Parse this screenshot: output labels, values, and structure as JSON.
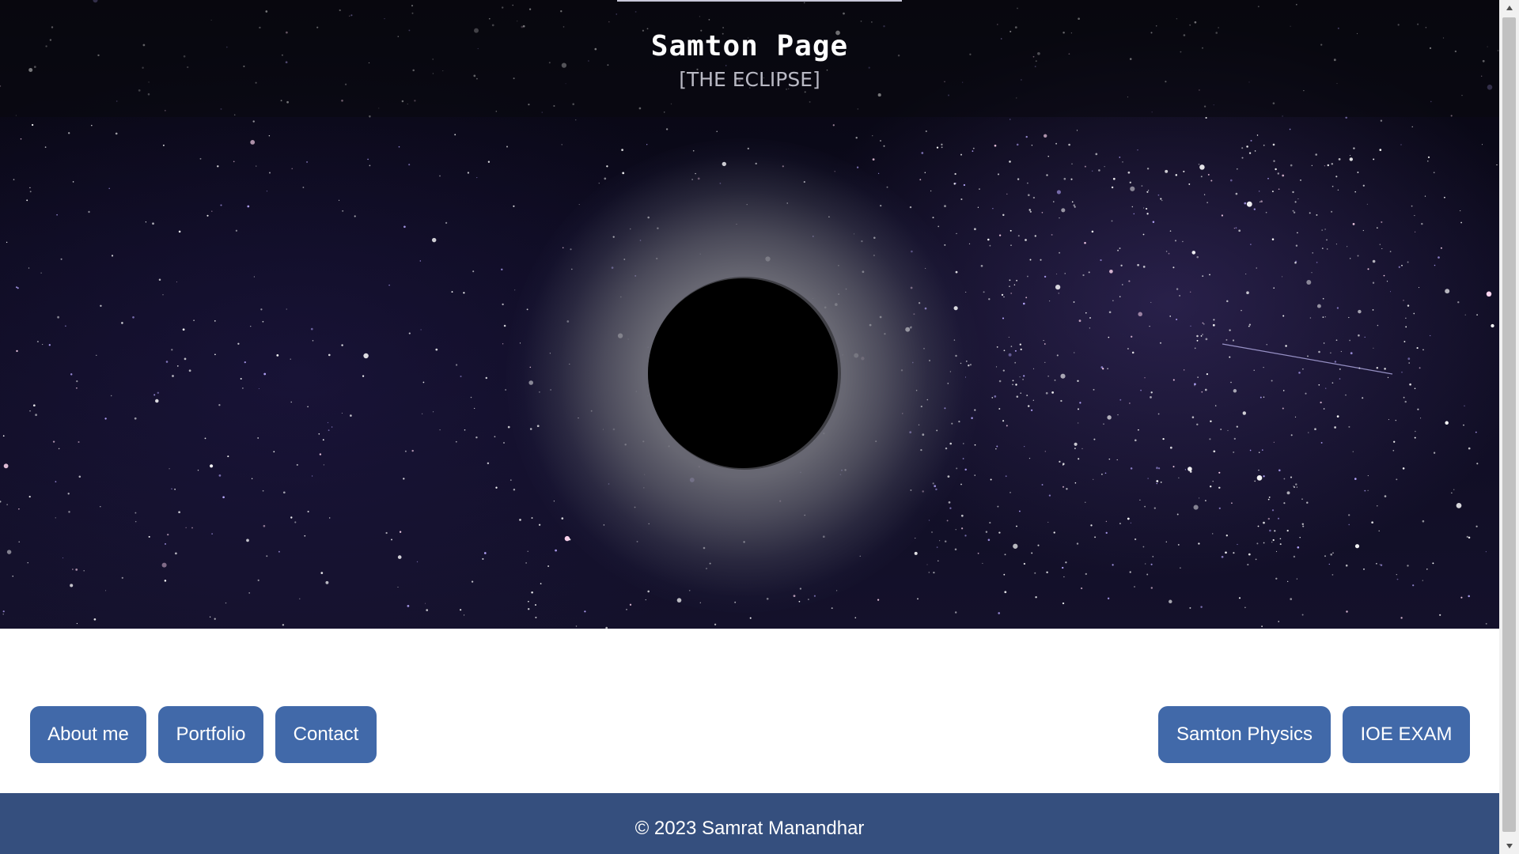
{
  "header": {
    "title": "Samton Page",
    "subtitle": "[THE ECLIPSE]"
  },
  "nav": {
    "left": [
      {
        "label": "About me"
      },
      {
        "label": "Portfolio"
      },
      {
        "label": "Contact"
      }
    ],
    "right": [
      {
        "label": "Samton Physics"
      },
      {
        "label": "IOE EXAM"
      }
    ]
  },
  "footer": {
    "text": "© 2023 Samrat Manandhar"
  },
  "colors": {
    "nav_button": "#4169a9",
    "footer_bg": "#354f7e",
    "hero_bg": "#0d0b1f"
  },
  "icons": {
    "scroll_up": "triangle-up-icon",
    "scroll_down": "triangle-down-icon"
  }
}
